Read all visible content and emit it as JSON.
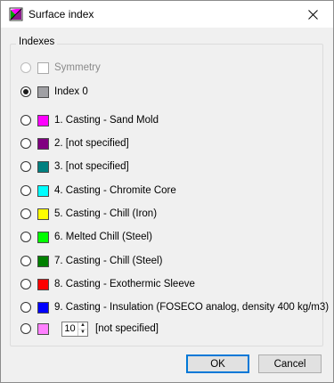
{
  "window": {
    "title": "Surface index",
    "app_icon": "surface-index-app-icon",
    "close_icon": "close-icon"
  },
  "group": {
    "label": "Indexes"
  },
  "rows": [
    {
      "label": "Symmetry",
      "color": "#ffffff",
      "checked": false,
      "disabled": true
    },
    {
      "label": "Index 0",
      "color": "#a0a0a4",
      "checked": true,
      "disabled": false
    },
    {
      "label": "1. Casting - Sand Mold",
      "color": "#ff00ff",
      "checked": false,
      "disabled": false
    },
    {
      "label": "2. [not specified]",
      "color": "#800080",
      "checked": false,
      "disabled": false
    },
    {
      "label": "3. [not specified]",
      "color": "#008080",
      "checked": false,
      "disabled": false
    },
    {
      "label": "4. Casting - Chromite Core",
      "color": "#00ffff",
      "checked": false,
      "disabled": false
    },
    {
      "label": "5. Casting - Chill (Iron)",
      "color": "#ffff00",
      "checked": false,
      "disabled": false
    },
    {
      "label": "6. Melted Chill (Steel)",
      "color": "#00ff00",
      "checked": false,
      "disabled": false
    },
    {
      "label": "7. Casting - Chill (Steel)",
      "color": "#008000",
      "checked": false,
      "disabled": false
    },
    {
      "label": "8. Casting - Exothermic Sleeve",
      "color": "#ff0000",
      "checked": false,
      "disabled": false
    },
    {
      "label": "9. Casting - Insulation (FOSECO analog, density 400 kg/m3)",
      "color": "#0000ff",
      "checked": false,
      "disabled": false
    }
  ],
  "custom_row": {
    "color": "#ff80ff",
    "value": "10",
    "label": "[not specified]"
  },
  "buttons": {
    "ok": "OK",
    "cancel": "Cancel"
  }
}
